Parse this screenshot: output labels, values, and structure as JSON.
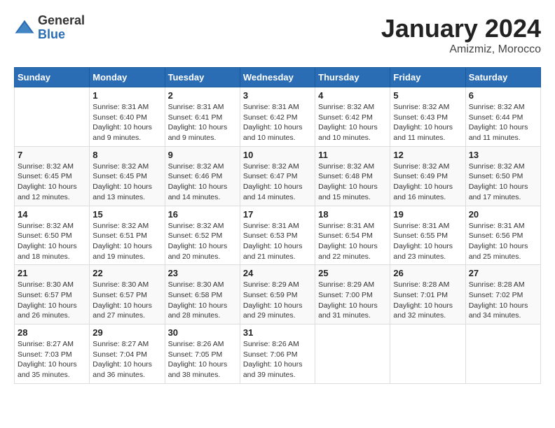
{
  "header": {
    "logo_general": "General",
    "logo_blue": "Blue",
    "main_title": "January 2024",
    "subtitle": "Amizmiz, Morocco"
  },
  "calendar": {
    "days_of_week": [
      "Sunday",
      "Monday",
      "Tuesday",
      "Wednesday",
      "Thursday",
      "Friday",
      "Saturday"
    ],
    "weeks": [
      [
        {
          "day": "",
          "info": ""
        },
        {
          "day": "1",
          "info": "Sunrise: 8:31 AM\nSunset: 6:40 PM\nDaylight: 10 hours\nand 9 minutes."
        },
        {
          "day": "2",
          "info": "Sunrise: 8:31 AM\nSunset: 6:41 PM\nDaylight: 10 hours\nand 9 minutes."
        },
        {
          "day": "3",
          "info": "Sunrise: 8:31 AM\nSunset: 6:42 PM\nDaylight: 10 hours\nand 10 minutes."
        },
        {
          "day": "4",
          "info": "Sunrise: 8:32 AM\nSunset: 6:42 PM\nDaylight: 10 hours\nand 10 minutes."
        },
        {
          "day": "5",
          "info": "Sunrise: 8:32 AM\nSunset: 6:43 PM\nDaylight: 10 hours\nand 11 minutes."
        },
        {
          "day": "6",
          "info": "Sunrise: 8:32 AM\nSunset: 6:44 PM\nDaylight: 10 hours\nand 11 minutes."
        }
      ],
      [
        {
          "day": "7",
          "info": "Sunrise: 8:32 AM\nSunset: 6:45 PM\nDaylight: 10 hours\nand 12 minutes."
        },
        {
          "day": "8",
          "info": "Sunrise: 8:32 AM\nSunset: 6:45 PM\nDaylight: 10 hours\nand 13 minutes."
        },
        {
          "day": "9",
          "info": "Sunrise: 8:32 AM\nSunset: 6:46 PM\nDaylight: 10 hours\nand 14 minutes."
        },
        {
          "day": "10",
          "info": "Sunrise: 8:32 AM\nSunset: 6:47 PM\nDaylight: 10 hours\nand 14 minutes."
        },
        {
          "day": "11",
          "info": "Sunrise: 8:32 AM\nSunset: 6:48 PM\nDaylight: 10 hours\nand 15 minutes."
        },
        {
          "day": "12",
          "info": "Sunrise: 8:32 AM\nSunset: 6:49 PM\nDaylight: 10 hours\nand 16 minutes."
        },
        {
          "day": "13",
          "info": "Sunrise: 8:32 AM\nSunset: 6:50 PM\nDaylight: 10 hours\nand 17 minutes."
        }
      ],
      [
        {
          "day": "14",
          "info": "Sunrise: 8:32 AM\nSunset: 6:50 PM\nDaylight: 10 hours\nand 18 minutes."
        },
        {
          "day": "15",
          "info": "Sunrise: 8:32 AM\nSunset: 6:51 PM\nDaylight: 10 hours\nand 19 minutes."
        },
        {
          "day": "16",
          "info": "Sunrise: 8:32 AM\nSunset: 6:52 PM\nDaylight: 10 hours\nand 20 minutes."
        },
        {
          "day": "17",
          "info": "Sunrise: 8:31 AM\nSunset: 6:53 PM\nDaylight: 10 hours\nand 21 minutes."
        },
        {
          "day": "18",
          "info": "Sunrise: 8:31 AM\nSunset: 6:54 PM\nDaylight: 10 hours\nand 22 minutes."
        },
        {
          "day": "19",
          "info": "Sunrise: 8:31 AM\nSunset: 6:55 PM\nDaylight: 10 hours\nand 23 minutes."
        },
        {
          "day": "20",
          "info": "Sunrise: 8:31 AM\nSunset: 6:56 PM\nDaylight: 10 hours\nand 25 minutes."
        }
      ],
      [
        {
          "day": "21",
          "info": "Sunrise: 8:30 AM\nSunset: 6:57 PM\nDaylight: 10 hours\nand 26 minutes."
        },
        {
          "day": "22",
          "info": "Sunrise: 8:30 AM\nSunset: 6:57 PM\nDaylight: 10 hours\nand 27 minutes."
        },
        {
          "day": "23",
          "info": "Sunrise: 8:30 AM\nSunset: 6:58 PM\nDaylight: 10 hours\nand 28 minutes."
        },
        {
          "day": "24",
          "info": "Sunrise: 8:29 AM\nSunset: 6:59 PM\nDaylight: 10 hours\nand 29 minutes."
        },
        {
          "day": "25",
          "info": "Sunrise: 8:29 AM\nSunset: 7:00 PM\nDaylight: 10 hours\nand 31 minutes."
        },
        {
          "day": "26",
          "info": "Sunrise: 8:28 AM\nSunset: 7:01 PM\nDaylight: 10 hours\nand 32 minutes."
        },
        {
          "day": "27",
          "info": "Sunrise: 8:28 AM\nSunset: 7:02 PM\nDaylight: 10 hours\nand 34 minutes."
        }
      ],
      [
        {
          "day": "28",
          "info": "Sunrise: 8:27 AM\nSunset: 7:03 PM\nDaylight: 10 hours\nand 35 minutes."
        },
        {
          "day": "29",
          "info": "Sunrise: 8:27 AM\nSunset: 7:04 PM\nDaylight: 10 hours\nand 36 minutes."
        },
        {
          "day": "30",
          "info": "Sunrise: 8:26 AM\nSunset: 7:05 PM\nDaylight: 10 hours\nand 38 minutes."
        },
        {
          "day": "31",
          "info": "Sunrise: 8:26 AM\nSunset: 7:06 PM\nDaylight: 10 hours\nand 39 minutes."
        },
        {
          "day": "",
          "info": ""
        },
        {
          "day": "",
          "info": ""
        },
        {
          "day": "",
          "info": ""
        }
      ]
    ]
  }
}
